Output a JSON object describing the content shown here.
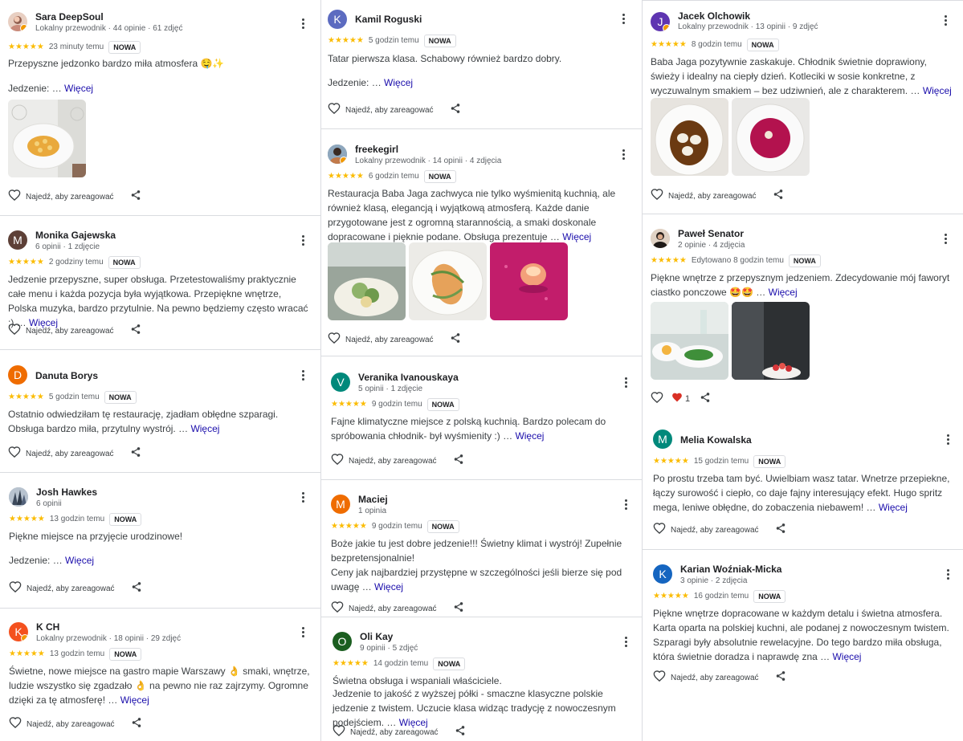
{
  "common": {
    "stars": "★★★★★",
    "new_badge": "NOWA",
    "more_label": "Więcej",
    "ellipsis": "… ",
    "react_hint": "Najedź, aby zareagować"
  },
  "reviews": [
    {
      "name": "Sara DeepSoul",
      "meta": "Lokalny przewodnik · 44 opinie · 61 zdjęć",
      "when": "23 minuty temu",
      "text": "Przepyszne jedzonko bardzo miła atmosfera 🤤✨",
      "text2": "Jedzenie: ",
      "initial": "",
      "avatar_color": "#c9a48f"
    },
    {
      "name": "Monika Gajewska",
      "meta": "6 opinii · 1 zdjęcie",
      "when": "2 godziny temu",
      "text": "Jedzenie przepyszne, super obsługa. Przetestowaliśmy praktycznie całe menu i każda pozycja była wyjątkowa. Przepiękne wnętrze, Polska muzyka, bardzo przytulnie. Na pewno będziemy często wracać ;) ",
      "initial": "M",
      "avatar_color": "#5d4037"
    },
    {
      "name": "Danuta Borys",
      "meta": "",
      "when": "5 godzin temu",
      "text": "Ostatnio odwiedziłam tę restaurację, zjadłam obłędne szparagi. Obsługa bardzo miła, przytulny wystrój. ",
      "initial": "D",
      "avatar_color": "#ef6c00"
    },
    {
      "name": "Josh Hawkes",
      "meta": "6 opinii",
      "when": "13 godzin temu",
      "text": "Piękne miejsce na przyjęcie urodzinowe!",
      "text2": "Jedzenie: ",
      "initial": "",
      "avatar_color": "#7f8fa6"
    },
    {
      "name": "K CH",
      "meta": "Lokalny przewodnik · 18 opinii · 29 zdjęć",
      "when": "13 godzin temu",
      "text": "Świetne, nowe miejsce na gastro mapie Warszawy 👌 smaki, wnętrze, ludzie wszystko się zgadzało 👌 na pewno nie raz zajrzymy. Ogromne dzięki za tę atmosferę! ",
      "initial": "K",
      "avatar_color": "#f4511e"
    },
    {
      "name": "Kamil Roguski",
      "meta": "",
      "when": "5 godzin temu",
      "text": "Tatar pierwsza klasa. Schabowy również bardzo dobry.",
      "text2": "Jedzenie: ",
      "initial": "K",
      "avatar_color": "#5c6bc0"
    },
    {
      "name": "freekegirl",
      "meta": "Lokalny przewodnik · 14 opinii · 4 zdjęcia",
      "when": "6 godzin temu",
      "text": "Restauracja Baba Jaga zachwyca nie tylko wyśmienitą kuchnią, ale również klasą, elegancją i wyjątkową atmosferą. Każde danie przygotowane jest z ogromną starannością, a smaki doskonale dopracowane i pięknie podane. Obsługa prezentuje ",
      "initial": "",
      "avatar_color": "#455a64"
    },
    {
      "name": "Veranika Ivanouskaya",
      "meta": "5 opinii · 1 zdjęcie",
      "when": "9 godzin temu",
      "text": "Fajne klimatyczne miejsce z polską kuchnią. Bardzo polecam do spróbowania chłodnik- był wyśmienity :) ",
      "initial": "V",
      "avatar_color": "#00897b"
    },
    {
      "name": "Maciej",
      "meta": "1 opinia",
      "when": "9 godzin temu",
      "text": "Boże jakie tu jest dobre jedzenie!!! Świetny klimat i wystrój! Zupełnie bezpretensjonalnie!",
      "text2": "Ceny jak najbardziej przystępne w szczególności jeśli bierze się pod uwagę ",
      "initial": "M",
      "avatar_color": "#ef6c00"
    },
    {
      "name": "Oli Kay",
      "meta": "9 opinii · 5 zdjęć",
      "when": "14 godzin temu",
      "text": "Świetna obsługa i wspaniali właściciele.",
      "text2": "Jedzenie to jakość z wyższej półki - smaczne klasyczne polskie jedzenie z twistem. Uczucie klasa widząc tradycję z nowoczesnym podejściem. ",
      "initial": "O",
      "avatar_color": "#1b5e20"
    },
    {
      "name": "Jacek Olchowik",
      "meta": "Lokalny przewodnik · 13 opinii · 9 zdjęć",
      "when": "8 godzin temu",
      "text": "Baba Jaga pozytywnie zaskakuje. Chłodnik świetnie doprawiony, świeży i idealny na ciepły dzień. Kotleciki w sosie konkretne, z wyczuwalnym smakiem – bez udziwnień, ale z charakterem. ",
      "initial": "J",
      "avatar_color": "#5e35b1"
    },
    {
      "name": "Paweł Senator",
      "meta": "2 opinie · 4 zdjęcia",
      "when": "Edytowano 8 godzin temu",
      "text": "Piękne wnętrze z przepysznym jedzeniem. Zdecydowanie mój faworyt ciastko ponczowe 🤩🤩 ",
      "initial": "",
      "avatar_color": "#6d4c41",
      "likes": "1"
    },
    {
      "name": "Melia Kowalska",
      "meta": "",
      "when": "15 godzin temu",
      "text": "Po prostu trzeba tam być. Uwielbiam wasz tatar. Wnetrze przepiekne, łączy surowość i ciepło, co daje fajny interesujący efekt. Hugo spritz mega, leniwe obłędne, do zobaczenia niebawem! ",
      "initial": "M",
      "avatar_color": "#00897b"
    },
    {
      "name": "Karian Woźniak-Micka",
      "meta": "3 opinie · 2 zdjęcia",
      "when": "16 godzin temu",
      "text": "Piękne wnętrze dopracowane w każdym detalu i świetna atmosfera. Karta oparta na polskiej kuchni, ale podanej z nowoczesnym twistem. Szparagi były absolutnie rewelacyjne. Do tego bardzo miła obsługa, która świetnie doradza i naprawdę zna ",
      "initial": "K",
      "avatar_color": "#1565c0"
    }
  ]
}
